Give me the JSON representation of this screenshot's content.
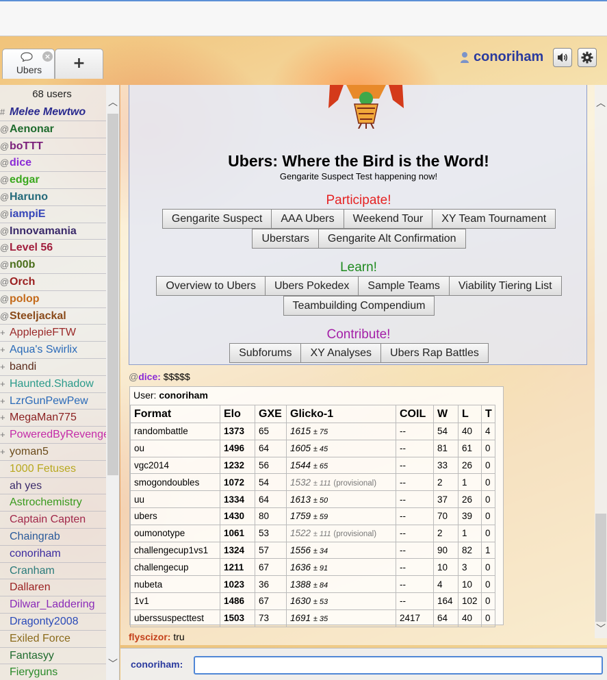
{
  "colors": {
    "brand_username": "#2a3a9e",
    "participate": "#e52222",
    "learn": "#1e8a1e",
    "contribute": "#a420a8"
  },
  "header": {
    "tab": {
      "label": "Ubers",
      "icon": "chat-bubble-icon",
      "close_icon": "close-icon"
    },
    "add_tab_label": "+",
    "username": "conoriham",
    "icons": [
      "user-icon",
      "sound-icon",
      "gear-icon"
    ]
  },
  "userlist": {
    "count_label": "68 users",
    "users": [
      {
        "rank": "#",
        "name": "Melee Mewtwo",
        "color": "#2b2b8f",
        "staff": true,
        "italic": true
      },
      {
        "rank": "@",
        "name": "Aenonar",
        "color": "#1f6b2e",
        "staff": true
      },
      {
        "rank": "@",
        "name": "boTTT",
        "color": "#7a1f7a",
        "staff": true
      },
      {
        "rank": "@",
        "name": "dice",
        "color": "#8a2bd6",
        "staff": true
      },
      {
        "rank": "@",
        "name": "edgar",
        "color": "#3aa81e",
        "staff": true
      },
      {
        "rank": "@",
        "name": "Haruno",
        "color": "#246a7a",
        "staff": true
      },
      {
        "rank": "@",
        "name": "iampiE",
        "color": "#3545b8",
        "staff": true
      },
      {
        "rank": "@",
        "name": "Innovamania",
        "color": "#3a2a6a",
        "staff": true
      },
      {
        "rank": "@",
        "name": "Level 56",
        "color": "#a11d3c",
        "staff": true
      },
      {
        "rank": "@",
        "name": "n00b",
        "color": "#4a6e1a",
        "staff": true
      },
      {
        "rank": "@",
        "name": "Orch",
        "color": "#9a1f1f",
        "staff": true
      },
      {
        "rank": "@",
        "name": "polop",
        "color": "#c46a1a",
        "staff": true
      },
      {
        "rank": "@",
        "name": "Steeljackal",
        "color": "#8a4a1a",
        "staff": true
      },
      {
        "rank": "+",
        "name": "ApplepieFTW",
        "color": "#9a2a2a"
      },
      {
        "rank": "+",
        "name": "Aqua's Swirlix",
        "color": "#2a6ab8"
      },
      {
        "rank": "+",
        "name": "bandi",
        "color": "#5a2a1a"
      },
      {
        "rank": "+",
        "name": "Haunted.Shadow",
        "color": "#2a9a8a"
      },
      {
        "rank": "+",
        "name": "LzrGunPewPew",
        "color": "#2a6ab8"
      },
      {
        "rank": "+",
        "name": "MegaMan775",
        "color": "#8a1f1f"
      },
      {
        "rank": "+",
        "name": "PoweredByRevenge",
        "color": "#c42aa8"
      },
      {
        "rank": "+",
        "name": "yoman5",
        "color": "#6a4a1a"
      },
      {
        "rank": "",
        "name": "1000 Fetuses",
        "color": "#b8a81e"
      },
      {
        "rank": "",
        "name": "ah yes",
        "color": "#3a2a6a"
      },
      {
        "rank": "",
        "name": "Astrochemistry",
        "color": "#3a9a1e"
      },
      {
        "rank": "",
        "name": "Captain Capten",
        "color": "#a1284a"
      },
      {
        "rank": "",
        "name": "Chaingrab",
        "color": "#2a5a9a"
      },
      {
        "rank": "",
        "name": "conoriham",
        "color": "#3a2a9e"
      },
      {
        "rank": "",
        "name": "Cranham",
        "color": "#2a7a7a"
      },
      {
        "rank": "",
        "name": "Dallaren",
        "color": "#9a1f1f"
      },
      {
        "rank": "",
        "name": "Dilwar_Laddering",
        "color": "#8a2ab8"
      },
      {
        "rank": "",
        "name": "Dragonty2008",
        "color": "#2a4ab8"
      },
      {
        "rank": "",
        "name": "Exiled Force",
        "color": "#8a6a1a"
      },
      {
        "rank": "",
        "name": "Fantasyy",
        "color": "#1f6b2e"
      },
      {
        "rank": "",
        "name": "Fieryguns",
        "color": "#2a8a2a"
      }
    ]
  },
  "intro": {
    "title": "Ubers: Where the Bird is the Word!",
    "subtitle": "Gengarite Suspect Test happening now!",
    "participate_head": "Participate!",
    "participate_buttons_row1": [
      "Gengarite Suspect",
      "AAA Ubers",
      "Weekend Tour",
      "XY Team Tournament"
    ],
    "participate_buttons_row2": [
      "Uberstars",
      "Gengarite Alt Confirmation"
    ],
    "learn_head": "Learn!",
    "learn_buttons_row1": [
      "Overview to Ubers",
      "Ubers Pokedex",
      "Sample Teams",
      "Viability Tiering List"
    ],
    "learn_buttons_row2": [
      "Teambuilding Compendium"
    ],
    "contribute_head": "Contribute!",
    "contribute_buttons": [
      "Subforums",
      "XY Analyses",
      "Ubers Rap Battles"
    ]
  },
  "messages": {
    "first": {
      "rank": "@",
      "nick": "dice:",
      "text": "$$$$$",
      "color": "#8a2bd6"
    },
    "last": {
      "rank": "",
      "nick": "flyscizor:",
      "text": "tru",
      "color": "#c4401a"
    }
  },
  "ranking": {
    "user_label": "User:",
    "user_name": "conoriham",
    "headers": [
      "Format",
      "Elo",
      "GXE",
      "Glicko-1",
      "COIL",
      "W",
      "L",
      "T"
    ],
    "rows": [
      {
        "format": "randombattle",
        "elo": "1373",
        "gxe": "65",
        "glicko": "1615",
        "dev": "± 75",
        "prov": "",
        "coil": "--",
        "w": "54",
        "l": "40",
        "t": "4"
      },
      {
        "format": "ou",
        "elo": "1496",
        "gxe": "64",
        "glicko": "1605",
        "dev": "± 45",
        "prov": "",
        "coil": "--",
        "w": "81",
        "l": "61",
        "t": "0"
      },
      {
        "format": "vgc2014",
        "elo": "1232",
        "gxe": "56",
        "glicko": "1544",
        "dev": "± 65",
        "prov": "",
        "coil": "--",
        "w": "33",
        "l": "26",
        "t": "0"
      },
      {
        "format": "smogondoubles",
        "elo": "1072",
        "gxe": "54",
        "glicko": "1532",
        "dev": "± 111",
        "prov": "(provisional)",
        "coil": "--",
        "w": "2",
        "l": "1",
        "t": "0"
      },
      {
        "format": "uu",
        "elo": "1334",
        "gxe": "64",
        "glicko": "1613",
        "dev": "± 50",
        "prov": "",
        "coil": "--",
        "w": "37",
        "l": "26",
        "t": "0"
      },
      {
        "format": "ubers",
        "elo": "1430",
        "gxe": "80",
        "glicko": "1759",
        "dev": "± 59",
        "prov": "",
        "coil": "--",
        "w": "70",
        "l": "39",
        "t": "0"
      },
      {
        "format": "oumonotype",
        "elo": "1061",
        "gxe": "53",
        "glicko": "1522",
        "dev": "± 111",
        "prov": "(provisional)",
        "coil": "--",
        "w": "2",
        "l": "1",
        "t": "0"
      },
      {
        "format": "challengecup1vs1",
        "elo": "1324",
        "gxe": "57",
        "glicko": "1556",
        "dev": "± 34",
        "prov": "",
        "coil": "--",
        "w": "90",
        "l": "82",
        "t": "1"
      },
      {
        "format": "challengecup",
        "elo": "1211",
        "gxe": "67",
        "glicko": "1636",
        "dev": "± 91",
        "prov": "",
        "coil": "--",
        "w": "10",
        "l": "3",
        "t": "0"
      },
      {
        "format": "nubeta",
        "elo": "1023",
        "gxe": "36",
        "glicko": "1388",
        "dev": "± 84",
        "prov": "",
        "coil": "--",
        "w": "4",
        "l": "10",
        "t": "0"
      },
      {
        "format": "1v1",
        "elo": "1486",
        "gxe": "67",
        "glicko": "1630",
        "dev": "± 53",
        "prov": "",
        "coil": "--",
        "w": "164",
        "l": "102",
        "t": "0"
      },
      {
        "format": "uberssuspecttest",
        "elo": "1503",
        "gxe": "73",
        "glicko": "1691",
        "dev": "± 35",
        "prov": "",
        "coil": "2417",
        "w": "64",
        "l": "40",
        "t": "0"
      }
    ]
  },
  "compose": {
    "label": "conoriham:",
    "value": ""
  }
}
